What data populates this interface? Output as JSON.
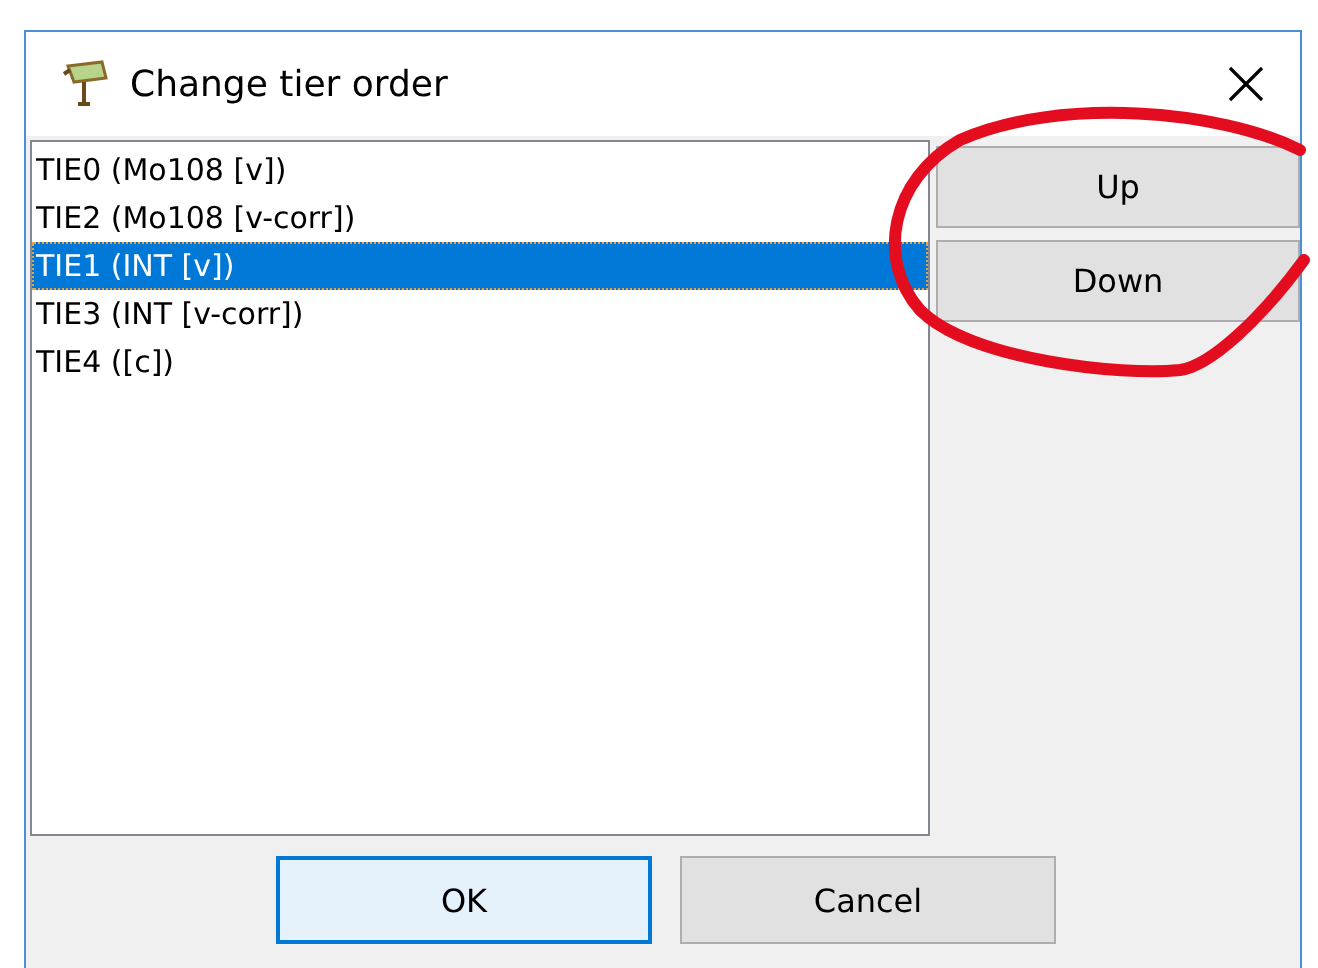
{
  "window": {
    "title": "Change tier order"
  },
  "tiers": [
    {
      "label": "TIE0 (Mo108 [v])",
      "selected": false
    },
    {
      "label": "TIE2 (Mo108 [v-corr])",
      "selected": false
    },
    {
      "label": "TIE1 (INT [v])",
      "selected": true
    },
    {
      "label": "TIE3 (INT [v-corr])",
      "selected": false
    },
    {
      "label": "TIE4 ([c])",
      "selected": false
    }
  ],
  "side_buttons": [
    "Up",
    "Down"
  ],
  "bottom_buttons": [
    {
      "label": "OK",
      "default": true
    },
    {
      "label": "Cancel",
      "default": false
    }
  ]
}
